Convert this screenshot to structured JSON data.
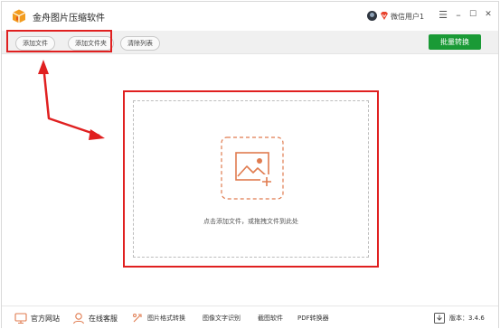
{
  "app": {
    "title": "金舟图片压缩软件"
  },
  "user": {
    "name": "微信用户1"
  },
  "window_controls": {
    "menu": "☰",
    "minimize": "–",
    "maximize": "☐",
    "close": "✕"
  },
  "toolbar": {
    "add_file": "添加文件",
    "add_folder": "添加文件夹",
    "clear_list": "清除列表",
    "batch_convert": "批量转换"
  },
  "dropzone": {
    "hint": "点击添加文件，或拖拽文件到此处"
  },
  "footer": {
    "official_site": "官方网站",
    "online_service": "在线客服",
    "links": [
      "图片格式转换",
      "图像文字识别",
      "截图软件",
      "PDF转换器"
    ],
    "version": "版本：3.4.6"
  },
  "colors": {
    "primary_green": "#1a9a36",
    "accent_orange": "#e07b4f",
    "annotation_red": "#e02020"
  },
  "icons": {
    "app_logo": "orange-box-logo-icon",
    "vip": "vip-diamond-icon",
    "upload": "image-add-icon",
    "official_site": "monitor-icon",
    "online_service": "headset-person-icon",
    "image_format": "image-convert-icon",
    "version": "download-icon"
  }
}
